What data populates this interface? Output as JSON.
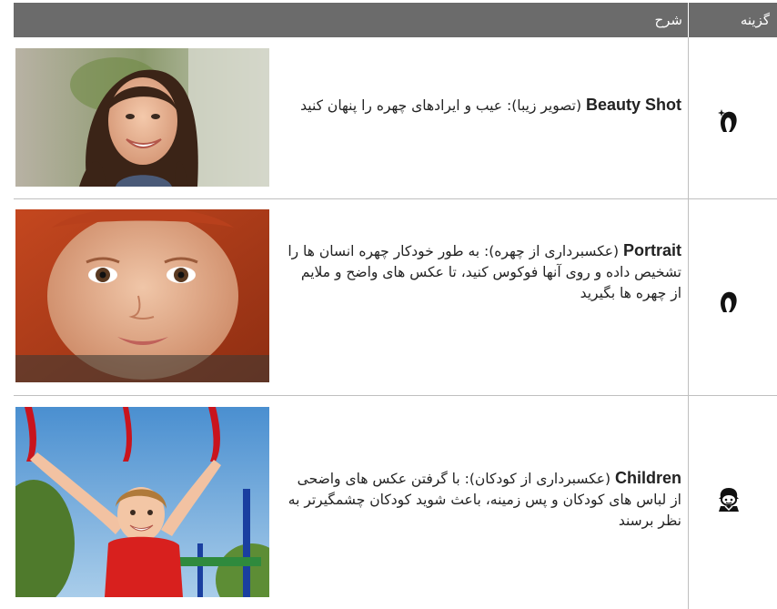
{
  "header": {
    "description_col": "شرح",
    "option_col": "گزینه"
  },
  "rows": [
    {
      "name": "Beauty Shot",
      "description": " (تصویر زیبا): عیب و ایرادهای چهره را پنهان کنید",
      "icon": "beauty-shot-icon",
      "photo": "smiling-woman-photo"
    },
    {
      "name": "Portrait",
      "description": " (عکسبرداری از چهره): به طور خودکار چهره انسان ها را تشخیص داده و روی آنها فوکوس کنید، تا عکس های واضح و ملایم از چهره ها بگیرید",
      "icon": "portrait-icon",
      "photo": "red-haired-child-photo"
    },
    {
      "name": "Children",
      "description": " (عکسبرداری از کودکان): با گرفتن عکس های واضحی از لباس های کودکان و پس زمینه، باعث شوید کودکان چشمگیرتر به نظر برسند",
      "icon": "children-icon",
      "photo": "child-on-playground-photo"
    }
  ],
  "colors": {
    "header_bg": "#6b6b6b",
    "rule": "#bfbfbf",
    "text": "#222222"
  }
}
